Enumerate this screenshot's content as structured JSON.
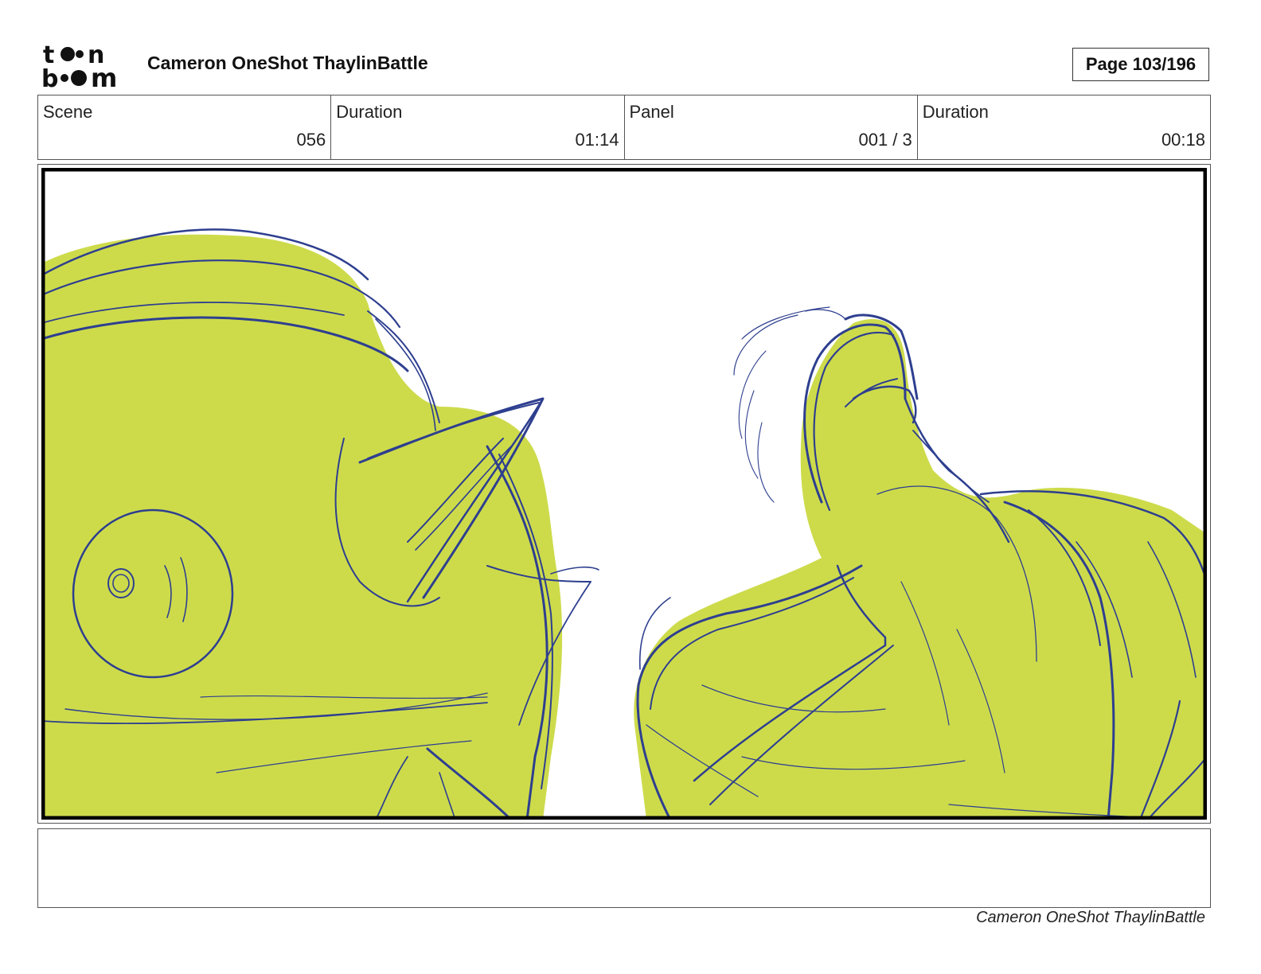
{
  "header": {
    "logo_text": [
      "to",
      "on",
      "bo",
      "om"
    ],
    "title": "Cameron OneShot ThaylinBattle",
    "page_label": "Page 103/196"
  },
  "info": {
    "scene_label": "Scene",
    "scene_value": "056",
    "scene_duration_label": "Duration",
    "scene_duration_value": "01:14",
    "panel_label": "Panel",
    "panel_value": "001 / 3",
    "panel_duration_label": "Duration",
    "panel_duration_value": "00:18"
  },
  "panel": {
    "fill_color": "#cddb4b",
    "line_color": "#2e3f8f"
  },
  "notes": {
    "text": ""
  },
  "footer": {
    "title": "Cameron OneShot ThaylinBattle"
  }
}
